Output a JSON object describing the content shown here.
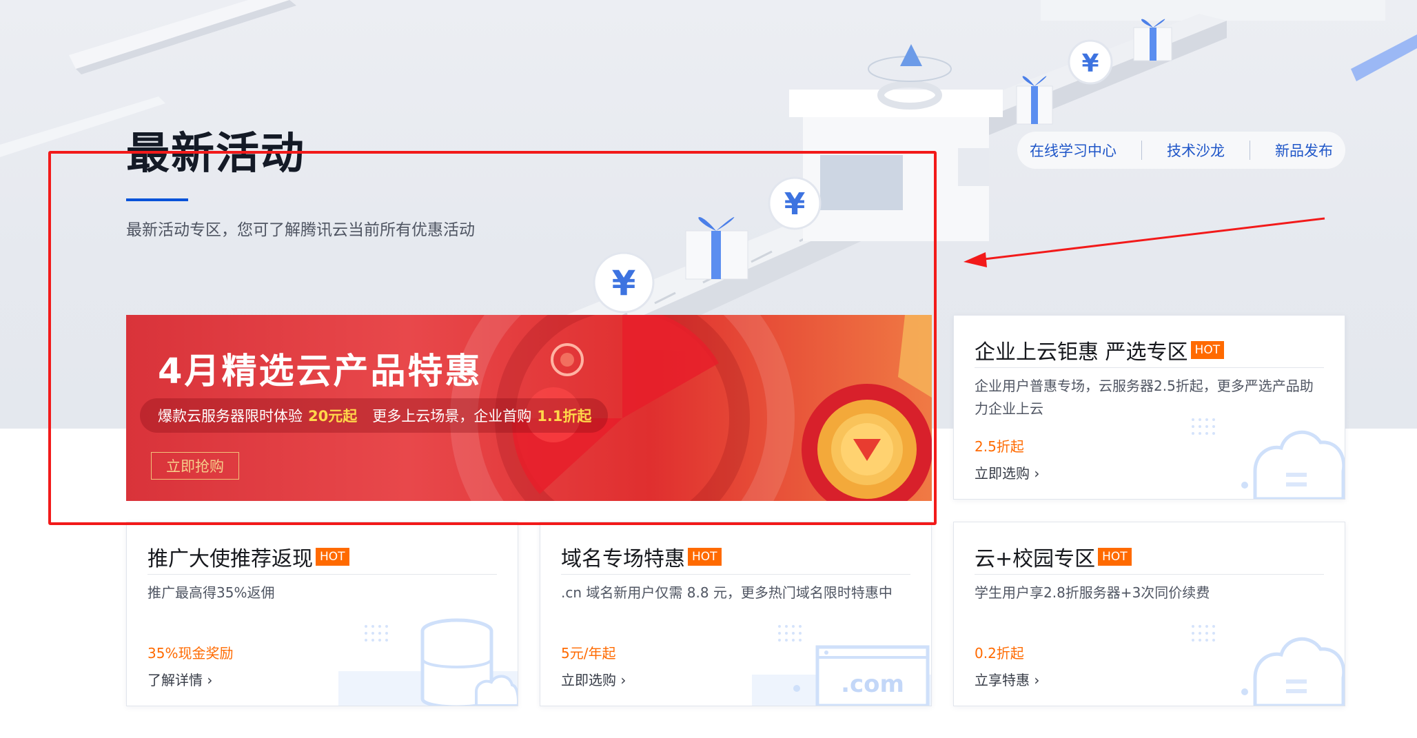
{
  "header": {
    "title": "最新活动",
    "subtitle": "最新活动专区，您可了解腾讯云当前所有优惠活动",
    "nav_links": [
      "在线学习中心",
      "技术沙龙",
      "新品发布"
    ]
  },
  "banner": {
    "title": "4月精选云产品特惠",
    "promo_text_1": "爆款云服务器限时体验",
    "promo_highlight_1": "20元起",
    "promo_text_2": "更多上云场景，企业首购",
    "promo_highlight_2": "1.1折起",
    "button_label": "立即抢购"
  },
  "cards": [
    {
      "title": "企业上云钜惠 严选专区",
      "badge": "HOT",
      "desc": "企业用户普惠专场，云服务器2.5折起，更多严选产品助力企业上云",
      "price": "2.5折起",
      "link": "立即选购",
      "icon": "cloud-icon"
    },
    {
      "title": "推广大使推荐返现",
      "badge": "HOT",
      "desc": "推广最高得35%返佣",
      "price": "35%现金奖励",
      "link": "了解详情",
      "icon": "database-cloud-icon"
    },
    {
      "title": "域名专场特惠",
      "badge": "HOT",
      "desc": ".cn 域名新用户仅需 8.8 元，更多热门域名限时特惠中",
      "price": "5元/年起",
      "link": "立即选购",
      "icon": "domain-com-icon",
      "icon_text": ".com"
    },
    {
      "title": "云+校园专区",
      "badge": "HOT",
      "desc": "学生用户享2.8折服务器+3次同价续费",
      "price": "0.2折起",
      "link": "立享特惠",
      "icon": "cloud-icon"
    }
  ],
  "colors": {
    "accent": "#0052d9",
    "hot_badge": "#ff6a00",
    "annotation": "#f21a1a",
    "banner_red": "#e02f2f",
    "banner_gold": "#ffd84a"
  }
}
